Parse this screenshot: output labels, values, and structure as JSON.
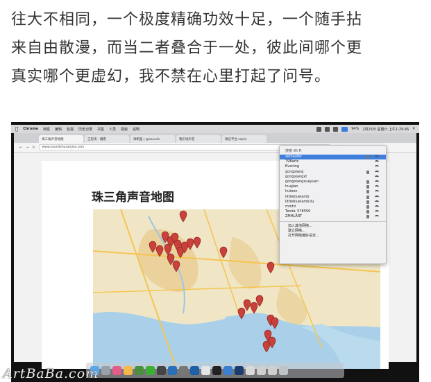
{
  "article": {
    "lines": [
      "往大不相同，一个极度精确功效十足，一个随手拈",
      "来自由散漫，而当二者叠合于一处，彼此间哪个更",
      "真实哪个更虚幻，我不禁在心里打起了问号。"
    ]
  },
  "menubar": {
    "items": [
      "Chrome",
      "档案",
      "编辑",
      "检视",
      "历史记录",
      "书签",
      "人员",
      "视窗",
      "说明"
    ],
    "battery": "94%",
    "clock": "2月25日 星期六 上午1:29:45"
  },
  "browser": {
    "tabs": [
      "珠三角声音地图",
      "王思涛 - 播客",
      "祥明鉴 | @soundc",
      "我们地声音",
      "微信平台 rapid"
    ],
    "url": "www.soundzhusanjiao.com"
  },
  "map_page": {
    "title": "珠三角声音地图"
  },
  "wifi_menu": {
    "header": "搜索 Wi-Fi",
    "networks": [
      "zeroauter",
      "798arts",
      "Evening",
      "gongxiang",
      "gongxiangxt",
      "gongxiangxueyuan",
      "huajian",
      "hutoon",
      "littlebluelamb",
      "littlebluelamb-bj",
      "mmtd",
      "Tenda_578550",
      "ZMHLART"
    ],
    "actions": [
      "加入其他网络…",
      "建立网络…",
      "打开网络偏好设定…"
    ]
  },
  "colors": {
    "accent": "#3f7fdc",
    "pin": "#c9413a",
    "text": "#333333"
  },
  "watermark": "ArtBaBa.com"
}
